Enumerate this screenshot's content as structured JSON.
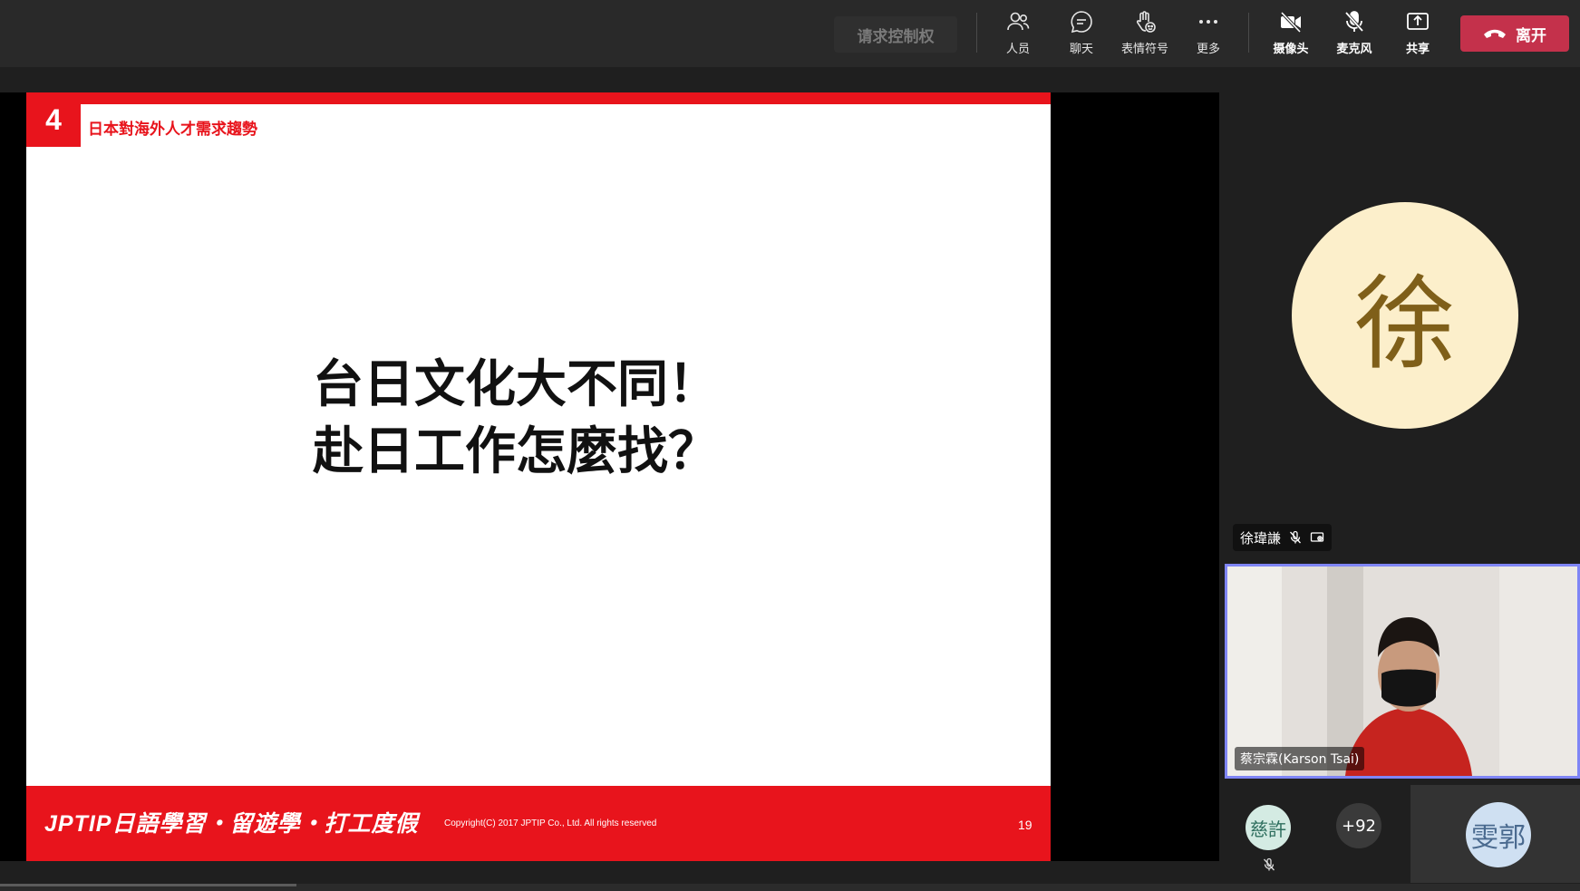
{
  "toolbar": {
    "request_control": "请求控制权",
    "people": "人员",
    "chat": "聊天",
    "reactions": "表情符号",
    "more": "更多",
    "camera": "摄像头",
    "mic": "麦克风",
    "share": "共享",
    "leave": "离开"
  },
  "slide": {
    "number": "4",
    "heading": "日本對海外人才需求趨勢",
    "line1": "台日文化大不同！",
    "line2": "赴日工作怎麼找？",
    "brand": "JPTIP日語學習・留遊學・打工度假",
    "copyright": "Copyright(C) 2017 JPTIP Co., Ltd. All rights reserved",
    "page": "19"
  },
  "participants": {
    "presenter_initial": "徐",
    "presenter_name": "徐瑋謙",
    "video_name": "蔡宗霖(Karson Tsai)",
    "avatar1": "慈許",
    "more_count": "+92",
    "avatar3": "雯郭"
  },
  "colors": {
    "accent_red": "#e8141c",
    "leave_red": "#c4314b",
    "active_border": "#7f85f5"
  }
}
